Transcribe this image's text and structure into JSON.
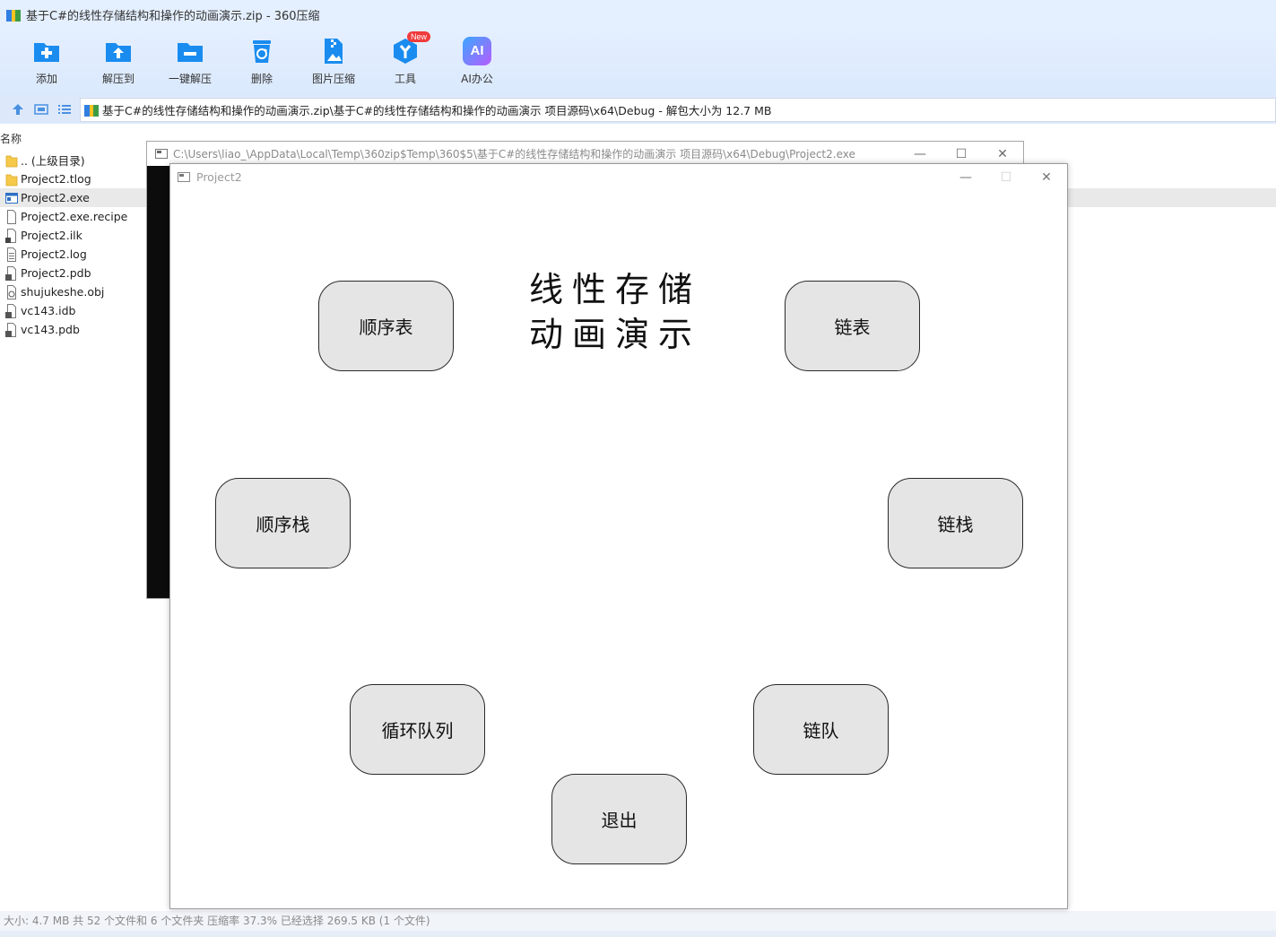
{
  "main_window": {
    "title": "基于C#的线性存储结构和操作的动画演示.zip - 360压缩",
    "toolbar": [
      {
        "id": "add",
        "label": "添加",
        "icon": "add-folder-icon"
      },
      {
        "id": "extract-to",
        "label": "解压到",
        "icon": "extract-folder-icon"
      },
      {
        "id": "one-click",
        "label": "一键解压",
        "icon": "one-click-extract-icon"
      },
      {
        "id": "delete",
        "label": "删除",
        "icon": "recycle-bin-icon"
      },
      {
        "id": "image-compress",
        "label": "图片压缩",
        "icon": "image-compress-icon"
      },
      {
        "id": "tools",
        "label": "工具",
        "icon": "tools-icon",
        "badge": "New"
      },
      {
        "id": "ai-office",
        "label": "AI办公",
        "icon": "ai-icon",
        "icon_text": "AI"
      }
    ],
    "address": "基于C#的线性存储结构和操作的动画演示.zip\\基于C#的线性存储结构和操作的动画演示 项目源码\\x64\\Debug - 解包大小为 12.7 MB",
    "list_header": "名称",
    "files": [
      {
        "name": ".. (上级目录)",
        "icon": "folder-icon"
      },
      {
        "name": "Project2.tlog",
        "icon": "folder-icon"
      },
      {
        "name": "Project2.exe",
        "icon": "exe-icon",
        "selected": true
      },
      {
        "name": "Project2.exe.recipe",
        "icon": "file-icon"
      },
      {
        "name": "Project2.ilk",
        "icon": "ilk-file-icon"
      },
      {
        "name": "Project2.log",
        "icon": "text-file-icon"
      },
      {
        "name": "Project2.pdb",
        "icon": "pdb-file-icon"
      },
      {
        "name": "shujukeshe.obj",
        "icon": "obj-file-icon"
      },
      {
        "name": "vc143.idb",
        "icon": "idb-file-icon"
      },
      {
        "name": "vc143.pdb",
        "icon": "pdb-file-icon"
      }
    ],
    "status": "大小: 4.7 MB 共 52 个文件和 6 个文件夹 压缩率 37.3% 已经选择 269.5 KB (1 个文件)"
  },
  "console_window": {
    "title": "C:\\Users\\liao_\\AppData\\Local\\Temp\\360zip$Temp\\360$5\\基于C#的线性存储结构和操作的动画演示 项目源码\\x64\\Debug\\Project2.exe",
    "minimize": "—",
    "maximize": "☐",
    "close": "✕"
  },
  "project_window": {
    "title": "Project2",
    "minimize": "—",
    "maximize": "☐",
    "close": "✕",
    "heading_line1": "线性存储",
    "heading_line2": "动画演示",
    "buttons": {
      "seq_list": "顺序表",
      "linked_list": "链表",
      "seq_stack": "顺序栈",
      "linked_stack": "链栈",
      "circular_queue": "循环队列",
      "linked_queue": "链队",
      "exit": "退出"
    }
  },
  "colors": {
    "accent_blue": "#1a8cf0",
    "titlebar_bg": "#e4efff",
    "button_bg": "#e5e5e6",
    "console_bg": "#0c0c0c",
    "badge_red": "#f03b3b"
  }
}
